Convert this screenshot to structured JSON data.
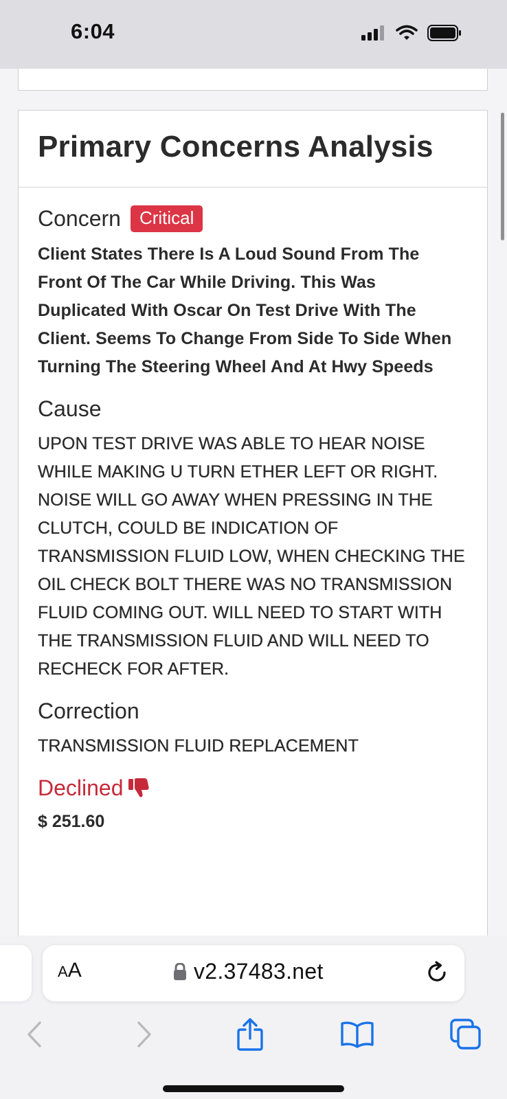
{
  "status_bar": {
    "time": "6:04"
  },
  "card": {
    "title": "Primary Concerns Analysis",
    "concern": {
      "heading": "Concern",
      "badge": "Critical",
      "text": "Client States There Is A Loud Sound From The Front Of The Car While Driving. This Was Duplicated With Oscar On Test Drive With The Client. Seems To Change From Side To Side When Turning The Steering Wheel And At Hwy Speeds"
    },
    "cause": {
      "heading": "Cause",
      "text": "UPON TEST DRIVE WAS ABLE TO HEAR NOISE WHILE MAKING U TURN ETHER LEFT OR RIGHT. NOISE WILL GO AWAY WHEN PRESSING IN THE CLUTCH, COULD BE INDICATION OF TRANSMISSION FLUID LOW, WHEN CHECKING THE OIL CHECK BOLT THERE WAS NO TRANSMISSION FLUID COMING OUT. WILL NEED TO START WITH THE TRANSMISSION FLUID AND WILL NEED TO RECHECK FOR AFTER."
    },
    "correction": {
      "heading": "Correction",
      "text": "TRANSMISSION FLUID REPLACEMENT"
    },
    "status": {
      "label": "Declined",
      "icon": "thumbs-down-icon"
    },
    "price": "$ 251.60"
  },
  "browser": {
    "aa_small": "A",
    "aa_large": "A",
    "url": "v2.37483.net"
  },
  "colors": {
    "critical": "#dc3545",
    "declined": "#c62a3a",
    "accent": "#1a73e8"
  }
}
